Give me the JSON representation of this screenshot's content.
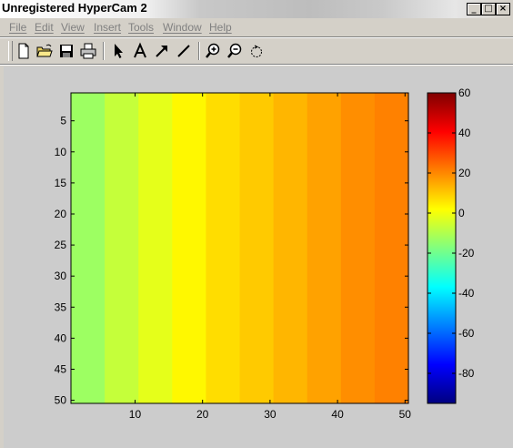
{
  "window": {
    "title": "Unregistered HyperCam 2",
    "controls": [
      "_",
      "□",
      "×"
    ]
  },
  "menu": {
    "items": [
      "File",
      "Edit",
      "View",
      "Insert",
      "Tools",
      "Window",
      "Help"
    ]
  },
  "toolbar": {
    "tools": [
      "new-file-icon",
      "open-folder-icon",
      "save-icon",
      "print-icon",
      "pointer-icon",
      "text-icon",
      "arrow-icon",
      "line-icon",
      "zoom-in-icon",
      "zoom-out-icon",
      "rotate-icon"
    ]
  },
  "chart_data": [
    {
      "type": "heatmap",
      "x": [
        1,
        50
      ],
      "y": [
        1,
        50
      ],
      "xticks": [
        10,
        20,
        30,
        40,
        50
      ],
      "yticks": [
        5,
        10,
        15,
        20,
        25,
        30,
        35,
        40,
        45,
        50
      ],
      "colormap": "jet",
      "column_band_values": [
        -13,
        -7,
        -2,
        3,
        7,
        10,
        13,
        16,
        19,
        21
      ],
      "colorbar": {
        "range": [
          -95,
          60
        ],
        "ticks": [
          60,
          40,
          20,
          0,
          -20,
          -40,
          -60,
          -80
        ]
      }
    }
  ]
}
